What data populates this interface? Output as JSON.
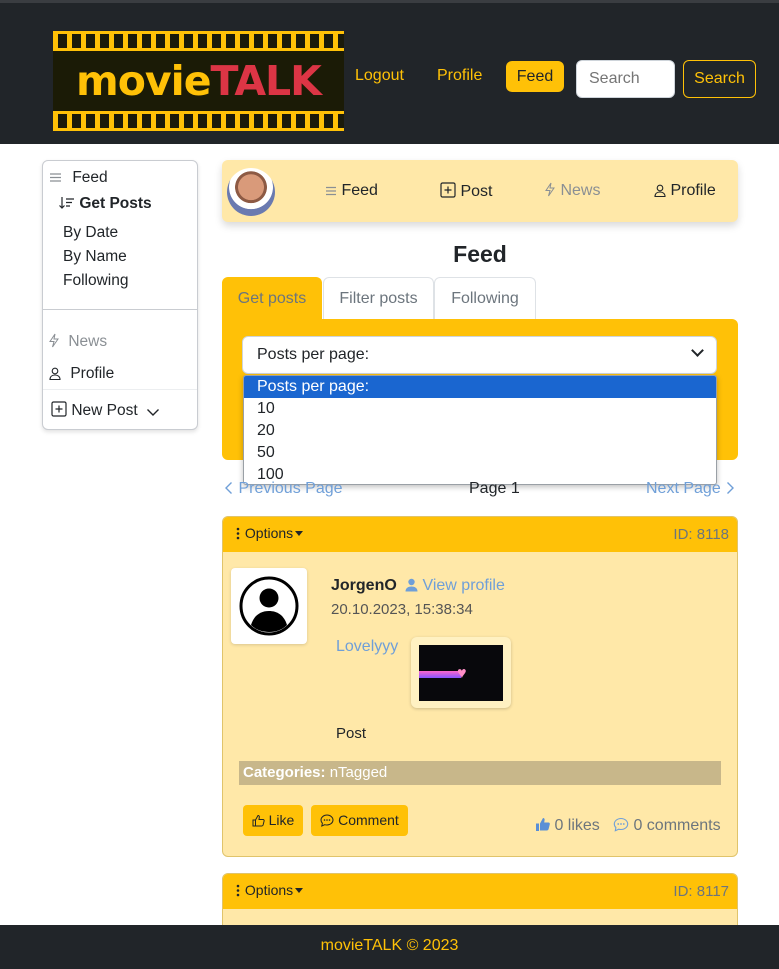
{
  "header": {
    "logo_left": "movie",
    "logo_right": "TALK",
    "nav": {
      "logout": "Logout",
      "profile": "Profile",
      "feed": "Feed"
    },
    "search_placeholder": "Search",
    "search_button": "Search"
  },
  "sidebar": {
    "feed": "Feed",
    "get_posts": "Get Posts",
    "sub_items": [
      "By Date",
      "By Name",
      "Following"
    ],
    "news": "News",
    "profile": "Profile",
    "new_post": "New Post"
  },
  "userbar": {
    "feed": "Feed",
    "post": "Post",
    "news": "News",
    "profile": "Profile"
  },
  "page_title": "Feed",
  "tabs": [
    "Get posts",
    "Filter posts",
    "Following"
  ],
  "posts_per_page": {
    "selected": "Posts per page:",
    "options": [
      "Posts per page:",
      "10",
      "20",
      "50",
      "100"
    ]
  },
  "pagination": {
    "prev": "Previous Page",
    "current": "Page 1",
    "next": "Next Page"
  },
  "posts": [
    {
      "options_label": "Options",
      "id_label": "ID: 8118",
      "author": "JorgenO",
      "view_profile": "View profile",
      "timestamp": "20.10.2023, 15:38:34",
      "title": "Lovelyyy",
      "type": "Post",
      "categories_label": "Categories:",
      "categories_value": "nTagged",
      "like_button": "Like",
      "comment_button": "Comment",
      "likes": "0 likes",
      "comments": "0 comments"
    },
    {
      "options_label": "Options",
      "id_label": "ID: 8117"
    }
  ],
  "footer": "movieTALK © 2023",
  "colors": {
    "accent": "#ffc107",
    "dark": "#212529",
    "card": "#ffe8a8",
    "link": "#6f9fd8",
    "select_highlight": "#1a66d0"
  },
  "icons": [
    "list-icon",
    "sort-icon",
    "lightning-icon",
    "person-icon",
    "plus-square-icon",
    "chevron-down-icon",
    "chevron-left-icon",
    "chevron-right-icon",
    "kebab-icon",
    "thumbs-up-icon",
    "chat-icon"
  ]
}
